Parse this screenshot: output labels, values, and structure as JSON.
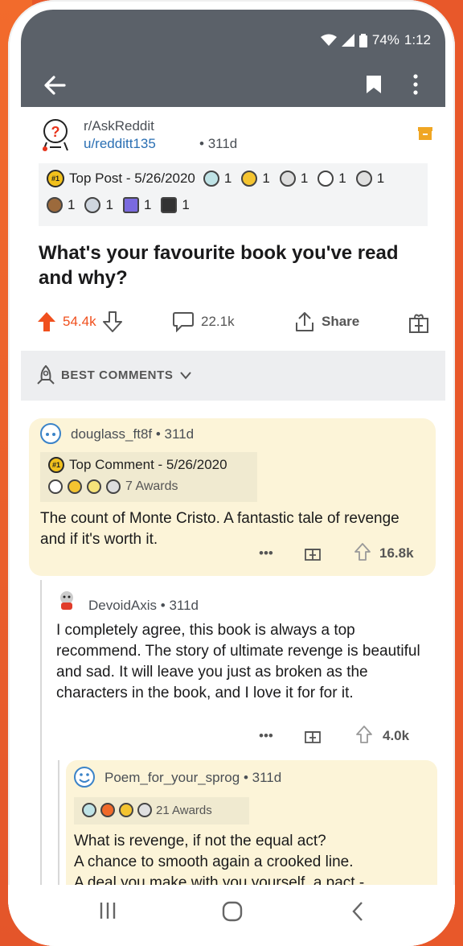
{
  "status": {
    "battery": "74%",
    "time": "1:12"
  },
  "post": {
    "subreddit": "r/AskReddit",
    "user": "u/redditt135",
    "age": "311d",
    "awards_line1": {
      "label": "Top Post - 5/26/2020",
      "counts": [
        "1",
        "1",
        "1",
        "1",
        "1"
      ]
    },
    "awards_line2": {
      "counts": [
        "1",
        "1",
        "1",
        "1"
      ]
    },
    "title": "What's your favourite book you've read and why?",
    "upvotes": "54.4k",
    "comments": "22.1k",
    "share_label": "Share"
  },
  "sort": {
    "label": "BEST COMMENTS"
  },
  "comments": [
    {
      "user": "douglass_ft8f",
      "age": "311d",
      "badge": "Top Comment - 5/26/2020",
      "awards": "7 Awards",
      "text": "The count of Monte Cristo. A fantastic tale of revenge and if it's worth it.",
      "score": "16.8k"
    },
    {
      "user": "DevoidAxis",
      "age": "311d",
      "text": "I completely agree, this book is always a top recommend.  The story of ultimate revenge is beautiful and sad. It will leave you just as broken as the characters in the book, and I love it for for it.",
      "score": "4.0k"
    },
    {
      "user": "Poem_for_your_sprog",
      "age": "311d",
      "awards": "21 Awards",
      "lines": [
        "What is revenge, if not the equal act?",
        "A chance to smooth again a crooked line.",
        "A deal you make with you yourself, a pact -"
      ]
    }
  ],
  "colors": {
    "upvote": "#f0501e",
    "header": "#5b6169",
    "comment_bg": "#fcf4d8",
    "link": "#2a6fb3"
  }
}
